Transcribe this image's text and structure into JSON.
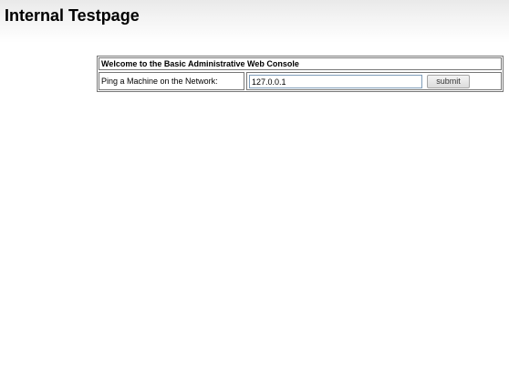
{
  "header": {
    "title": "Internal Testpage"
  },
  "console": {
    "heading": "Welcome to the Basic Administrative Web Console",
    "ping_label": "Ping a Machine on the Network:",
    "ip_value": "127.0.0.1",
    "submit_label": "submit"
  }
}
